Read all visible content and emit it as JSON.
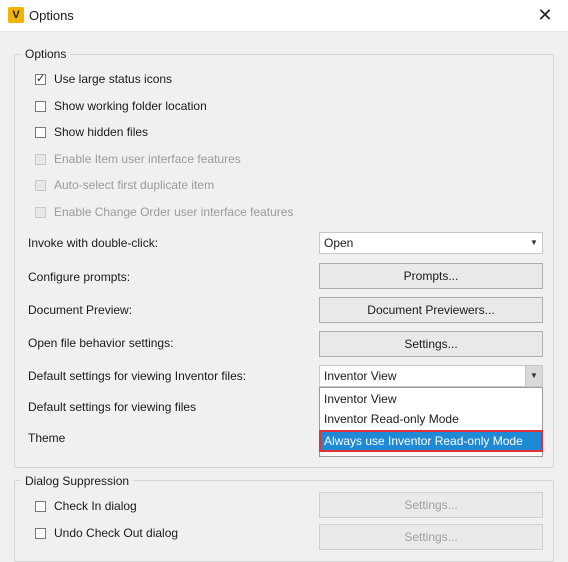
{
  "window": {
    "title": "Options",
    "app_icon_glyph": "V",
    "close_glyph": "✕"
  },
  "options_group": {
    "legend": "Options",
    "checkboxes": [
      {
        "label": "Use large status icons",
        "checked": true,
        "enabled": true
      },
      {
        "label": "Show working folder location",
        "checked": false,
        "enabled": true
      },
      {
        "label": "Show hidden files",
        "checked": false,
        "enabled": true
      },
      {
        "label": "Enable Item user interface features",
        "checked": false,
        "enabled": false
      },
      {
        "label": "Auto-select first duplicate item",
        "checked": false,
        "enabled": false
      },
      {
        "label": "Enable Change Order user interface features",
        "checked": false,
        "enabled": false
      }
    ],
    "invoke_label": "Invoke with double-click:",
    "invoke_value": "Open",
    "configure_prompts_label": "Configure prompts:",
    "prompts_button": "Prompts...",
    "document_preview_label": "Document Preview:",
    "document_previewers_button": "Document Previewers...",
    "open_file_label": "Open file behavior settings:",
    "open_file_button": "Settings...",
    "inventor_label": "Default settings for viewing Inventor files:",
    "inventor_value": "Inventor View",
    "viewing_files_label": "Default settings for viewing files",
    "theme_label": "Theme",
    "inventor_dropdown_options": [
      "Inventor View",
      "Inventor Read-only Mode",
      "Always use Inventor Read-only Mode"
    ],
    "inventor_dropdown_highlighted": "Always use Inventor Read-only Mode"
  },
  "dialog_suppression_group": {
    "legend": "Dialog Suppression",
    "rows": [
      {
        "label": "Check In dialog",
        "button": "Settings..."
      },
      {
        "label": "Undo Check Out dialog",
        "button": "Settings..."
      }
    ]
  },
  "colors": {
    "highlight": "#1e8ad6",
    "highlight_outline": "#e0303a",
    "app_icon": "#f2b400"
  }
}
